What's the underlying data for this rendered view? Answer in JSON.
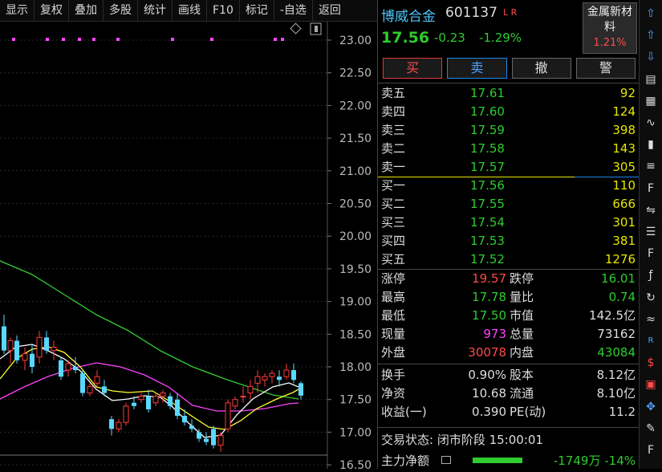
{
  "toolbar": [
    "显示",
    "复权",
    "叠加",
    "多股",
    "统计",
    "画线",
    "F10",
    "标记",
    "-自选",
    "返回"
  ],
  "chart": {
    "y_labels": [
      "23.00",
      "22.50",
      "22.00",
      "21.50",
      "21.00",
      "20.50",
      "20.00",
      "19.50",
      "19.00",
      "18.50",
      "18.00",
      "17.50",
      "17.00",
      "16.50"
    ],
    "colors": {
      "up": "#ff3b3b",
      "down": "#5ad8ff",
      "ma5": "#ffffff",
      "ma10": "#ffff33",
      "ma20": "#ff44ff",
      "ma60": "#33cc33"
    }
  },
  "stock": {
    "name": "博威合金",
    "code": "601137",
    "flags": "L R",
    "price": "17.56",
    "change": "-0.23",
    "change_pct": "-1.29%",
    "sector": "金属新材料",
    "sector_pct": "1.21%"
  },
  "actions": {
    "buy": "买",
    "sell": "卖",
    "cancel": "撤",
    "alert": "警"
  },
  "asks": [
    {
      "label": "卖五",
      "price": "17.61",
      "vol": "92"
    },
    {
      "label": "卖四",
      "price": "17.60",
      "vol": "124"
    },
    {
      "label": "卖三",
      "price": "17.59",
      "vol": "398"
    },
    {
      "label": "卖二",
      "price": "17.58",
      "vol": "143"
    },
    {
      "label": "卖一",
      "price": "17.57",
      "vol": "305"
    }
  ],
  "bids": [
    {
      "label": "买一",
      "price": "17.56",
      "vol": "110"
    },
    {
      "label": "买二",
      "price": "17.55",
      "vol": "666"
    },
    {
      "label": "买三",
      "price": "17.54",
      "vol": "301"
    },
    {
      "label": "买四",
      "price": "17.53",
      "vol": "381"
    },
    {
      "label": "买五",
      "price": "17.52",
      "vol": "1276"
    }
  ],
  "stats1": [
    {
      "k1": "涨停",
      "v1": "19.57",
      "c1": "#ff4a4a",
      "k2": "跌停",
      "v2": "16.01",
      "c2": "#2ecc2e"
    },
    {
      "k1": "最高",
      "v1": "17.78",
      "c1": "#2ecc2e",
      "k2": "量比",
      "v2": "0.74",
      "c2": "#2ecc2e"
    },
    {
      "k1": "最低",
      "v1": "17.50",
      "c1": "#2ecc2e",
      "k2": "市值",
      "v2": "142.5亿",
      "c2": "#dddddd"
    },
    {
      "k1": "现量",
      "v1": "973",
      "c1": "#ff44ff",
      "k2": "总量",
      "v2": "73162",
      "c2": "#dddddd"
    },
    {
      "k1": "外盘",
      "v1": "30078",
      "c1": "#ff4a4a",
      "k2": "内盘",
      "v2": "43084",
      "c2": "#2ecc2e"
    }
  ],
  "stats2": [
    {
      "k1": "换手",
      "v1": "0.90%",
      "c1": "#dddddd",
      "k2": "股本",
      "v2": "8.12亿",
      "c2": "#dddddd"
    },
    {
      "k1": "净资",
      "v1": "10.68",
      "c1": "#dddddd",
      "k2": "流通",
      "v2": "8.10亿",
      "c2": "#dddddd"
    },
    {
      "k1": "收益(一)",
      "v1": "0.390",
      "c1": "#dddddd",
      "k2": "PE(动)",
      "v2": "11.2",
      "c2": "#dddddd"
    }
  ],
  "status": "交易状态: 闭市阶段 15:00:01",
  "main_flow": {
    "label": "主力净额",
    "value": "-1749万 -14%"
  },
  "sidebar_icons": [
    "arrow-up-icon",
    "arrow-up-outline-icon",
    "arrow-down-outline-icon",
    "report-icon",
    "grid-icon",
    "line-chart-icon",
    "candle-icon",
    "list-icon",
    "f10-icon",
    "compare-icon",
    "rank-icon",
    "f12-icon",
    "f-x-icon",
    "refresh-icon",
    "wave-icon",
    "rsi-icon",
    "money-icon",
    "stop-icon",
    "move-icon",
    "pencil-icon",
    "f5-icon"
  ]
}
